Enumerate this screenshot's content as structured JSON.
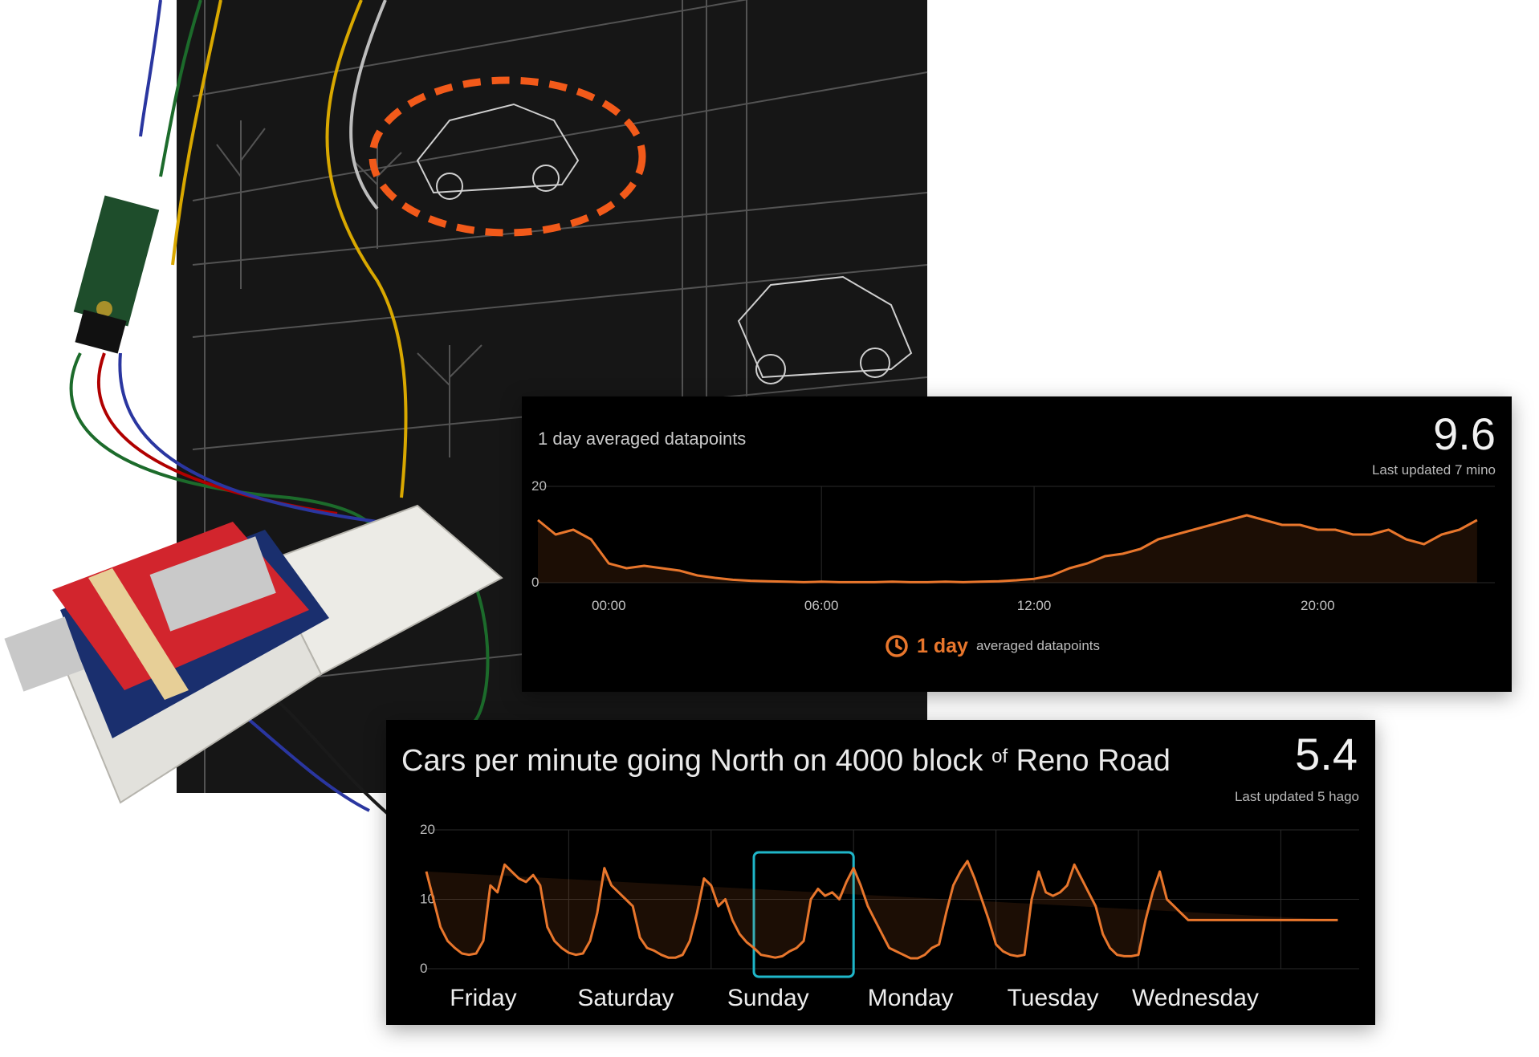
{
  "colors": {
    "accent": "#e8762c",
    "highlight": "#1fb6c9",
    "panel_bg": "#000000",
    "grid": "#2a2a2a"
  },
  "day_panel": {
    "title": "1 day averaged datapoints",
    "value": "9.6",
    "updated": "Last updated 7 mino",
    "footer": {
      "icon": "clock-icon",
      "period": "1 day",
      "label": "averaged datapoints"
    }
  },
  "week_panel": {
    "title_main": "Cars per minute going North on 4000 block",
    "title_of": "of",
    "title_end": "Reno Road",
    "value": "5.4",
    "updated": "Last updated 5 hago"
  },
  "chart_data": [
    {
      "type": "area",
      "name": "day_chart",
      "ylim": [
        0,
        20
      ],
      "y_ticks": [
        0,
        20
      ],
      "x_ticks": [
        "00:00",
        "06:00",
        "12:00",
        "20:00"
      ],
      "xlim": [
        -2,
        25
      ],
      "grid": true,
      "x": [
        -2,
        -1.5,
        -1,
        -0.5,
        0,
        0.5,
        1,
        1.5,
        2,
        2.5,
        3,
        3.5,
        4,
        4.5,
        5,
        5.5,
        6,
        6.5,
        7,
        7.5,
        8,
        8.5,
        9,
        9.5,
        10,
        10.5,
        11,
        11.5,
        12,
        12.5,
        13,
        13.5,
        14,
        14.5,
        15,
        15.5,
        16,
        16.5,
        17,
        17.5,
        18,
        18.5,
        19,
        19.5,
        20,
        20.5,
        21,
        21.5,
        22,
        22.5,
        23,
        23.5,
        24,
        24.5
      ],
      "y": [
        13,
        10,
        11,
        9,
        4,
        3,
        3.5,
        3,
        2.5,
        1.5,
        1,
        0.6,
        0.4,
        0.3,
        0.2,
        0.1,
        0.2,
        0.1,
        0.1,
        0.1,
        0.2,
        0.1,
        0.1,
        0.2,
        0.1,
        0.2,
        0.3,
        0.5,
        0.8,
        1.5,
        3,
        4,
        5.5,
        6,
        7,
        9,
        10,
        11,
        12,
        13,
        14,
        13,
        12,
        12,
        11,
        11,
        10,
        10,
        11,
        9,
        8,
        10,
        11,
        13
      ]
    },
    {
      "type": "area",
      "name": "week_chart",
      "ylim": [
        0,
        20
      ],
      "y_ticks": [
        0,
        10,
        20
      ],
      "categories": [
        "Friday",
        "Saturday",
        "Sunday",
        "Monday",
        "Tuesday",
        "Wednesday"
      ],
      "xlim": [
        0,
        6.55
      ],
      "grid": true,
      "highlight_range": [
        2.3,
        3.0
      ],
      "x": [
        0,
        0.05,
        0.1,
        0.15,
        0.2,
        0.25,
        0.3,
        0.35,
        0.4,
        0.45,
        0.5,
        0.55,
        0.6,
        0.65,
        0.7,
        0.75,
        0.8,
        0.85,
        0.9,
        0.95,
        1,
        1.05,
        1.1,
        1.15,
        1.2,
        1.25,
        1.3,
        1.35,
        1.4,
        1.45,
        1.5,
        1.55,
        1.6,
        1.65,
        1.7,
        1.75,
        1.8,
        1.85,
        1.9,
        1.95,
        2,
        2.05,
        2.1,
        2.15,
        2.2,
        2.25,
        2.3,
        2.35,
        2.4,
        2.45,
        2.5,
        2.55,
        2.6,
        2.65,
        2.7,
        2.75,
        2.8,
        2.85,
        2.9,
        2.95,
        3,
        3.05,
        3.1,
        3.15,
        3.2,
        3.25,
        3.3,
        3.35,
        3.4,
        3.45,
        3.5,
        3.55,
        3.6,
        3.65,
        3.7,
        3.75,
        3.8,
        3.85,
        3.9,
        3.95,
        4,
        4.05,
        4.1,
        4.15,
        4.2,
        4.25,
        4.3,
        4.35,
        4.4,
        4.45,
        4.5,
        4.55,
        4.6,
        4.65,
        4.7,
        4.75,
        4.8,
        4.85,
        4.9,
        4.95,
        5,
        5.05,
        5.1,
        5.15,
        5.2,
        5.25,
        5.3,
        5.35,
        5.4,
        5.45,
        5.5,
        5.55,
        5.6,
        5.65,
        5.7,
        5.75,
        5.8,
        6,
        6.2,
        6.4,
        6.55
      ],
      "y": [
        14,
        10,
        6,
        4,
        3,
        2.2,
        2,
        2.2,
        4,
        12,
        11,
        15,
        14,
        13,
        12.5,
        13.5,
        12,
        6,
        4,
        3,
        2.3,
        2,
        2.2,
        4,
        8,
        14.5,
        12,
        11,
        10,
        9,
        4.5,
        3,
        2.6,
        2,
        1.6,
        1.6,
        2,
        4,
        8,
        13,
        12,
        9,
        10,
        7,
        5,
        3.8,
        3,
        2,
        1.8,
        1.6,
        1.8,
        2.5,
        3,
        4,
        10,
        11.5,
        10.5,
        11,
        10,
        12.5,
        14.5,
        12,
        9,
        7,
        5,
        3,
        2.5,
        2,
        1.5,
        1.5,
        2,
        3,
        3.5,
        8,
        12,
        14,
        15.5,
        13,
        10,
        7,
        3.5,
        2.5,
        2,
        1.8,
        2,
        10,
        14,
        11,
        10.5,
        11,
        12,
        15,
        13,
        11,
        9,
        5,
        3,
        2,
        1.8,
        1.8,
        2,
        7,
        11,
        14,
        10,
        9,
        8,
        7,
        7,
        7,
        7,
        7,
        7,
        7,
        7,
        7,
        7,
        7,
        7,
        7
      ]
    }
  ]
}
